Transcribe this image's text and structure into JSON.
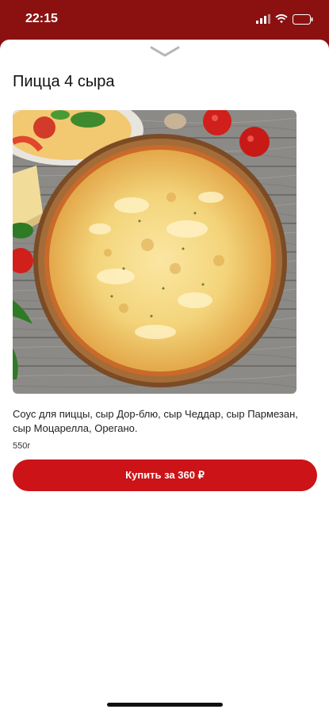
{
  "status_bar": {
    "time": "22:15",
    "icons": [
      "signal-icon",
      "wifi-icon",
      "battery-icon"
    ]
  },
  "product": {
    "title": "Пицца 4 сыра",
    "description": "Соус для пиццы, сыр Дор-блю, сыр Чеддар, сыр Пармезан, сыр Моцарелла, Орегано.",
    "weight": "550г",
    "buy_label": "Купить за 360 ₽"
  },
  "colors": {
    "header_red": "#8b1111",
    "button_red": "#cc1318",
    "background": "#ffffff"
  }
}
